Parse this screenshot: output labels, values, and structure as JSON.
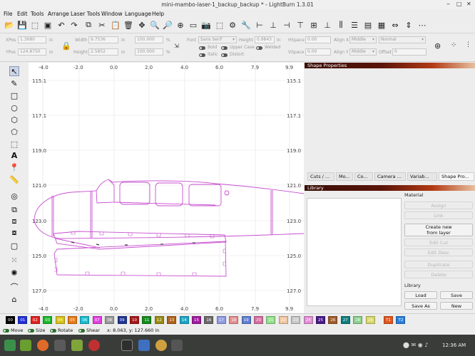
{
  "window": {
    "title": "mini-mambo-laser-1_backup_backup * - LightBurn 1.3.01",
    "controls": {
      "minimize": "‒",
      "maximize": "□",
      "close": "✕"
    }
  },
  "menu": [
    "File",
    "Edit",
    "Tools",
    "Arrange",
    "Laser Tools",
    "Window",
    "Language",
    "Help"
  ],
  "editbar": {
    "xpos_label": "XPos",
    "xpos": "1.3680",
    "ypos_label": "YPos",
    "ypos": "124.8750",
    "unit": "in",
    "width_label": "Width",
    "width": "9.7536",
    "height_label": "Height",
    "height": "2.5852",
    "scale_w": "100.000",
    "scale_h": "100.000",
    "pct": "%",
    "font_label": "Font",
    "font": "Sans Serif",
    "text_height_label": "Height",
    "text_height": "0.9843",
    "bold": "Bold",
    "italic": "Italic",
    "upper_case": "Upper Case",
    "distort": "Distort",
    "welded": "Welded",
    "hspace_label": "HSpace",
    "hspace": "0.00",
    "vspace_label": "VSpace",
    "vspace": "0.00",
    "align_x_label": "Align X",
    "align_x": "Middle",
    "align_y_label": "Align Y",
    "align_y": "Middle",
    "normal": "Normal",
    "offset_label": "Offset",
    "offset": "0"
  },
  "canvas": {
    "x_ticks": [
      "-4.0",
      "-2.0",
      "0.0",
      "2.0",
      "4.0",
      "6.0",
      "7.9",
      "9.9"
    ],
    "y_ticks": [
      "115.1",
      "117.1",
      "119.0",
      "121.0",
      "123.0",
      "125.0",
      "127.0"
    ],
    "shape_color": "#c84fd0"
  },
  "panels": {
    "shape_properties": "Shape Properties",
    "tabs": [
      "Cuts / ...",
      "Mo...",
      "Co...",
      "Camera ...",
      "Variab...",
      "Shape Pro..."
    ],
    "library": "Library",
    "material": "Material",
    "buttons": {
      "assign": "Assign",
      "link": "Link",
      "create_new": "Create new\nfrom layer",
      "edit_cut": "Edit Cut",
      "edit_desc": "Edit Desc",
      "duplicate": "Duplicate",
      "delete": "Delete"
    },
    "library_section": "Library",
    "lib_buttons": {
      "load": "Load",
      "save": "Save",
      "save_as": "Save As",
      "new": "New"
    }
  },
  "palette": [
    {
      "label": "00",
      "color": "#000000"
    },
    {
      "label": "01",
      "color": "#1f2fd8"
    },
    {
      "label": "02",
      "color": "#e02020"
    },
    {
      "label": "03",
      "color": "#1ab82a"
    },
    {
      "label": "04",
      "color": "#d7c31a"
    },
    {
      "label": "05",
      "color": "#e97a15"
    },
    {
      "label": "06",
      "color": "#19bcd3"
    },
    {
      "label": "07",
      "color": "#e23ee0"
    },
    {
      "label": "08",
      "color": "#9a9a9a"
    },
    {
      "label": "09",
      "color": "#1f3595"
    },
    {
      "label": "10",
      "color": "#a41616"
    },
    {
      "label": "11",
      "color": "#148a1c"
    },
    {
      "label": "12",
      "color": "#9a8b12"
    },
    {
      "label": "13",
      "color": "#b0621a"
    },
    {
      "label": "14",
      "color": "#1aa6c7"
    },
    {
      "label": "15",
      "color": "#a01aa0"
    },
    {
      "label": "16",
      "color": "#6a6a6a"
    },
    {
      "label": "17",
      "color": "#8f9be3"
    },
    {
      "label": "18",
      "color": "#e38f8f"
    },
    {
      "label": "19",
      "color": "#5f7fd2"
    },
    {
      "label": "20",
      "color": "#d46f9f"
    },
    {
      "label": "21",
      "color": "#93e08a"
    },
    {
      "label": "22",
      "color": "#f2c5a0"
    },
    {
      "label": "23",
      "color": "#c8c8c8"
    },
    {
      "label": "24",
      "color": "#e28fd6"
    },
    {
      "label": "25",
      "color": "#4a1a8a"
    },
    {
      "label": "26",
      "color": "#a05a2a"
    },
    {
      "label": "27",
      "color": "#0f7c7c"
    },
    {
      "label": "28",
      "color": "#8ad08a"
    },
    {
      "label": "29",
      "color": "#d8d86a"
    },
    {
      "label": "T1",
      "color": "#e2551c"
    },
    {
      "label": "T2",
      "color": "#2a7fd8"
    }
  ],
  "status": {
    "move": "Move",
    "size": "Size",
    "rotate": "Rotate",
    "shear": "Shear",
    "coords": "x: 8.063, y: 127.660 in"
  },
  "taskbar": {
    "clock": "12:36 AM"
  }
}
